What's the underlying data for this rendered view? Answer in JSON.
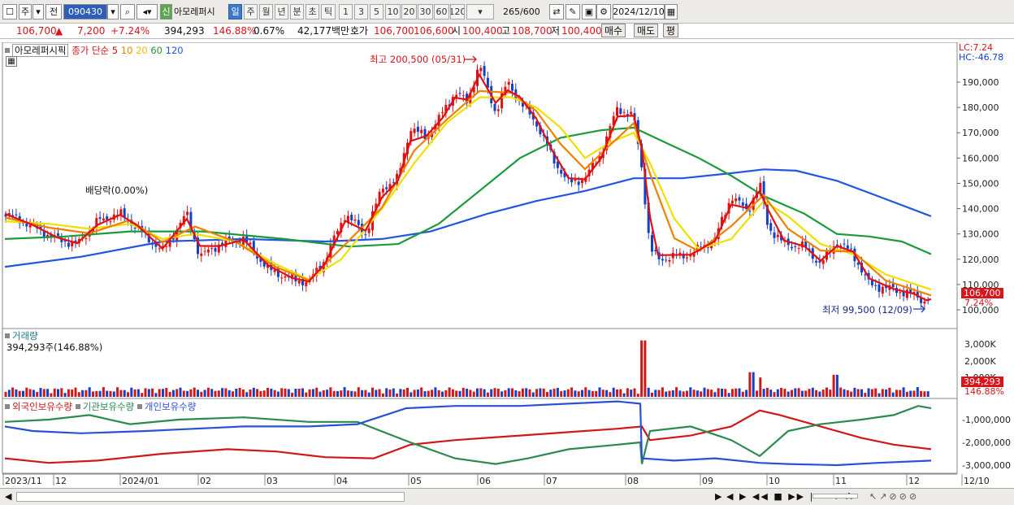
{
  "toolbar": {
    "menu_icon": "menu-icon",
    "stock_type": "주",
    "prev_label": "전",
    "code": "090430",
    "name": "아모레퍼시",
    "new_tag": "신",
    "periods": [
      "일",
      "주",
      "월",
      "년",
      "분",
      "초",
      "틱"
    ],
    "active_period": "일",
    "minutes": [
      "1",
      "3",
      "5",
      "10",
      "20",
      "30",
      "60",
      "120"
    ],
    "range": "265",
    "range_total": "/600",
    "date": "2024/12/10"
  },
  "quote": {
    "price": "106,700",
    "arrow": "▲",
    "change": "7,200",
    "change_pct": "+7.24%",
    "volume": "394,293",
    "vol_ratio": "146.88%",
    "turnover": "0.67%",
    "amount": "42,177백만",
    "bid_label": "호가",
    "ask": "106,700",
    "bid": "106,600",
    "open_label": "시",
    "open": "100,400",
    "high_label": "고",
    "high": "108,700",
    "low_label": "저",
    "low": "100,400",
    "buy": "매수",
    "sell": "매도",
    "avg": "평"
  },
  "price_panel": {
    "name": "아모레퍼시픽",
    "ma_label": "종가 단순",
    "ma_periods": [
      "5",
      "10",
      "20",
      "60",
      "120"
    ],
    "ma_colors": [
      "#e01010",
      "#f08000",
      "#f0e000",
      "#1a9a3a",
      "#2255e0"
    ],
    "dividend": "배당락(0.00%)",
    "high_note": "최고 200,500 (05/31)",
    "low_note": "최저 99,500 (12/09)",
    "lc": "LC:7.24",
    "hc": "HC:-46.78",
    "price_tag": "106,700",
    "price_tag_pct": "7.24%",
    "ylabels": [
      "190,000",
      "180,000",
      "170,000",
      "160,000",
      "150,000",
      "140,000",
      "130,000",
      "120,000",
      "110,000",
      "100,000"
    ]
  },
  "volume_panel": {
    "title": "거래량",
    "value": "394,293주(146.88%)",
    "ylabels": [
      "3,000K",
      "2,000K",
      "1,000K"
    ],
    "tag": "394,293",
    "tag_pct": "146.88%"
  },
  "holding_panel": {
    "titles": [
      "외국인보유수량",
      "기관보유수량",
      "개인보유수량"
    ],
    "colors": [
      "#d01818",
      "#2a8a50",
      "#2a50d8"
    ],
    "ylabels": [
      "-1,000,000",
      "-2,000,000",
      "-3,000,000"
    ]
  },
  "xaxis": {
    "labels": [
      "2023/11",
      "12",
      "2024/01",
      "02",
      "03",
      "04",
      "05",
      "06",
      "07",
      "08",
      "09",
      "10",
      "11",
      "12",
      "12/10"
    ]
  },
  "bottom": {
    "controls": "◀ ▶ ◀◀ ■ ▶▶ | − + A"
  }
}
